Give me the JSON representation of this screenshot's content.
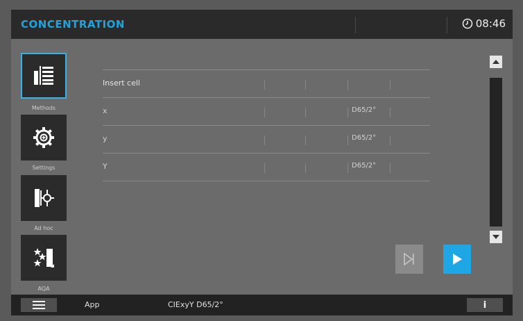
{
  "header": {
    "title": "CONCENTRATION",
    "time": "08:46"
  },
  "nav": [
    {
      "label": "Methods",
      "icon": "methods-icon",
      "selected": true
    },
    {
      "label": "Settings",
      "icon": "gear-icon",
      "selected": false
    },
    {
      "label": "Ad hoc",
      "icon": "adhoc-icon",
      "selected": false
    },
    {
      "label": "AQA",
      "icon": "aqa-icon",
      "selected": false
    }
  ],
  "table": {
    "rows": [
      {
        "label": "Insert cell",
        "illuminant": ""
      },
      {
        "label": "x",
        "illuminant": "D65/2°"
      },
      {
        "label": "y",
        "illuminant": "D65/2°"
      },
      {
        "label": "Y",
        "illuminant": "D65/2°"
      }
    ]
  },
  "footer": {
    "app_label": "App",
    "method_label": "CIExyY D65/2°",
    "info_label": "i"
  },
  "colors": {
    "accent": "#1fa3dc",
    "play_button": "#1ea7e4",
    "selected_border": "#3ab0e8"
  }
}
